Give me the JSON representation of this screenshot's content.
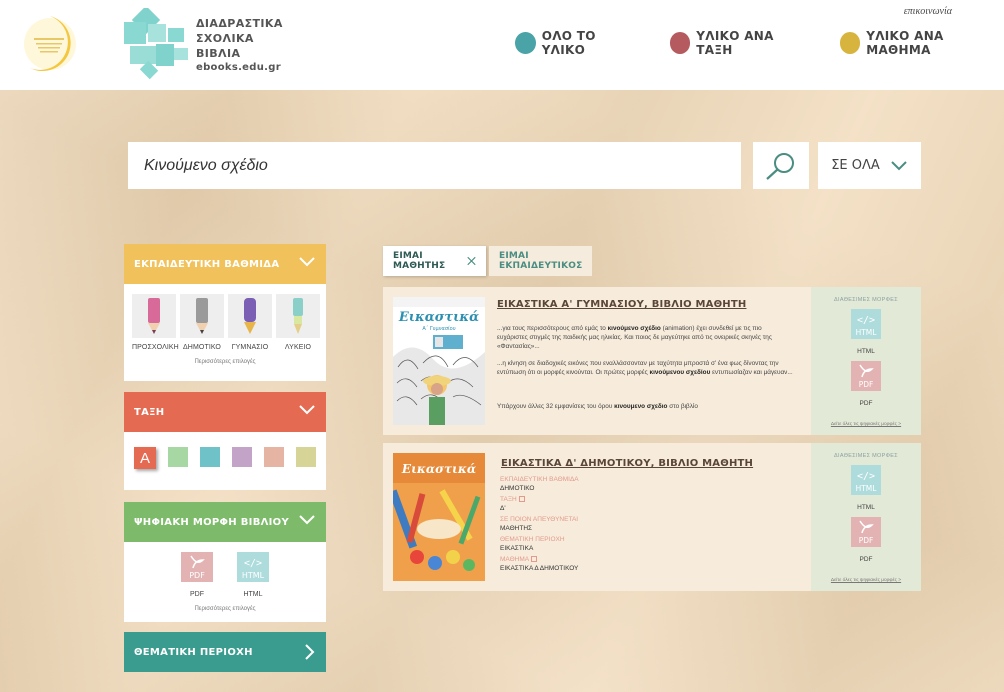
{
  "header": {
    "brand_line1": "ΔΙΑΔΡΑΣΤΙΚΑ",
    "brand_line2": "ΣΧΟΛΙΚΑ",
    "brand_line3": "ΒΙΒΛΙΑ",
    "brand_url": "ebooks.edu.gr",
    "contact": "επικοινωνία",
    "nav": [
      {
        "label": "ΟΛΟ ΤΟ ΥΛΙΚΟ",
        "color": "#4aa3a6"
      },
      {
        "label": "ΥΛΙΚΟ ΑΝΑ ΤΑΞΗ",
        "color": "#b55a5f"
      },
      {
        "label": "ΥΛΙΚΟ ΑΝΑ ΜΑΘΗΜΑ",
        "color": "#d6b43e"
      }
    ]
  },
  "search": {
    "value": "Κινούμενο σχέδιο",
    "scope_label": "ΣΕ ΟΛΑ"
  },
  "sidebar": {
    "level": {
      "title": "ΕΚΠΑΙΔΕΥΤΙΚΗ ΒΑΘΜΙΔΑ",
      "color": "#f1c15c",
      "items": [
        "ΠΡΟΣΧΟΛΙΚΗ",
        "ΔΗΜΟΤΙΚΟ",
        "ΓΥΜΝΑΣΙΟ",
        "ΛΥΚΕΙΟ"
      ],
      "more": "Περισσότερες επιλογές"
    },
    "class": {
      "title": "ΤΑΞΗ",
      "color": "#e56a52",
      "selected": "A",
      "colors": [
        "#a7d8a4",
        "#6fc2c8",
        "#c4a3c8",
        "#e6b4a3",
        "#d6d496"
      ]
    },
    "format": {
      "title": "ΨΗΦΙΑΚΗ ΜΟΡΦΗ ΒΙΒΛΙΟΥ",
      "color": "#7dbb6a",
      "items": [
        "PDF",
        "HTML"
      ],
      "more": "Περισσότερες επιλογές"
    },
    "subject": {
      "title": "ΘΕΜΑΤΙΚΗ ΠΕΡΙΟΧΗ",
      "color": "#3a9c8e"
    }
  },
  "tags": {
    "student": "ΕΙΜΑΙ ΜΑΘΗΤΗΣ",
    "teacher": "ΕΙΜΑΙ ΕΚΠΑΙΔΕΥΤΙΚΟΣ"
  },
  "results": [
    {
      "title": "ΕΙΚΑΣΤΙΚΑ Α' ΓΥΜΝΑΣΙΟΥ, ΒΙΒΛΙΟ ΜΑΘΗΤΗ",
      "cover_title": "Εικαστικά",
      "cover_sub": "Α΄ Γυμνασίου",
      "snippet1_pre": "...για τους περισσότερους από εμάς το ",
      "snippet1_bold": "κινούμενο σχέδιο",
      "snippet1_post": " (animation) έχει συνδεθεί με τις πιο ευχάριστες στιγμές της παιδικής μας ηλικίας. Και ποιος δε μαγεύτηκε από τις ονειρικές σκηνές της «Φαντασίας»...",
      "snippet2_pre": "...η κίνηση σε διαδοχικές εικόνες που εναλλάσσονταν με ταχύτητα μπροστά σ' ένα φως δίνοντας την εντύπωση ότι οι μορφές κινούνται. Οι πρώτες μορφές ",
      "snippet2_bold": "κινούμενου σχεδίου",
      "snippet2_post": " εντυπωσίαζαν και μάγευαν...",
      "more_pre": "Υπάρχουν άλλες 32 εμφανίσεις του όρου ",
      "more_bold": "κινουμενο σχεδιο",
      "more_post": " στο βιβλίο",
      "formats_head": "ΔΙΑΘΕΣΙΜΕΣ ΜΟΡΦΕΣ",
      "formats": [
        "HTML",
        "PDF"
      ],
      "formats_all": "Δείτε όλες τις ψηφιακές μορφές >"
    },
    {
      "title": "ΕΙΚΑΣΤΙΚΑ Δ' ΔΗΜΟΤΙΚΟΥ, ΒΙΒΛΙΟ ΜΑΘΗΤΗ",
      "meta": [
        {
          "k": "ΕΚΠΑΙΔΕΥΤΙΚΗ ΒΑΘΜΙΔΑ",
          "v": "ΔΗΜΟΤΙΚΟ"
        },
        {
          "k": "ΤΑΞΗ",
          "v": "Δ'"
        },
        {
          "k": "ΣΕ ΠΟΙΟΝ ΑΠΕΥΘΥΝΕΤΑΙ",
          "v": "ΜΑΘΗΤΗΣ"
        },
        {
          "k": "ΘΕΜΑΤΙΚΗ ΠΕΡΙΟΧΗ",
          "v": "ΕΙΚΑΣΤΙΚΑ"
        },
        {
          "k": "ΜΑΘΗΜΑ",
          "v": "ΕΙΚΑΣΤΙΚΑ Δ ΔΗΜΟΤΙΚΟΥ"
        }
      ],
      "formats_head": "ΔΙΑΘΕΣΙΜΕΣ ΜΟΡΦΕΣ",
      "formats": [
        "HTML",
        "PDF"
      ],
      "formats_all": "Δείτε όλες τις ψηφιακές μορφές >"
    }
  ]
}
